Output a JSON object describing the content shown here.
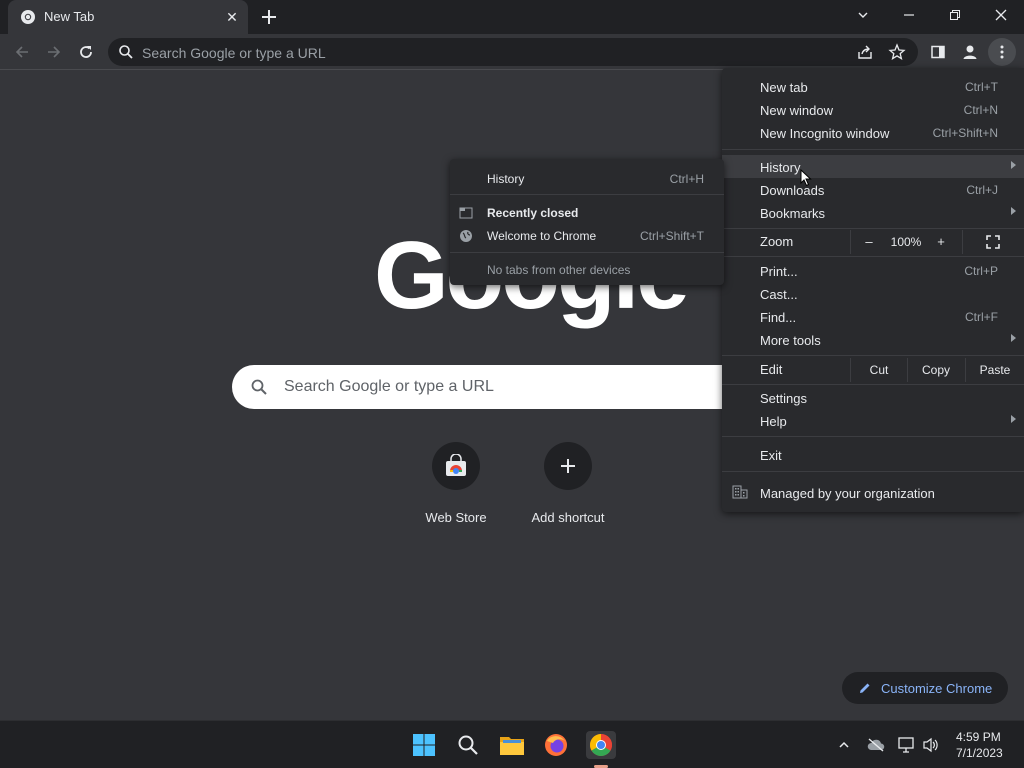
{
  "tab": {
    "title": "New Tab"
  },
  "omnibox": {
    "placeholder": "Search Google or type a URL"
  },
  "logo": {
    "text": "Google"
  },
  "ntp": {
    "search_placeholder": "Search Google or type a URL",
    "shortcuts": [
      {
        "label": "Web Store",
        "icon": "web-store-icon"
      },
      {
        "label": "Add shortcut",
        "icon": "plus-icon"
      }
    ],
    "customize_label": "Customize Chrome"
  },
  "menu": {
    "new_tab": {
      "label": "New tab",
      "shortcut": "Ctrl+T"
    },
    "new_window": {
      "label": "New window",
      "shortcut": "Ctrl+N"
    },
    "new_incognito": {
      "label": "New Incognito window",
      "shortcut": "Ctrl+Shift+N"
    },
    "history": {
      "label": "History"
    },
    "downloads": {
      "label": "Downloads",
      "shortcut": "Ctrl+J"
    },
    "bookmarks": {
      "label": "Bookmarks"
    },
    "zoom": {
      "label": "Zoom",
      "minus": "–",
      "level": "100%",
      "plus": "+"
    },
    "print": {
      "label": "Print...",
      "shortcut": "Ctrl+P"
    },
    "cast": {
      "label": "Cast..."
    },
    "find": {
      "label": "Find...",
      "shortcut": "Ctrl+F"
    },
    "more_tools": {
      "label": "More tools"
    },
    "edit": {
      "label": "Edit",
      "cut": "Cut",
      "copy": "Copy",
      "paste": "Paste"
    },
    "settings": {
      "label": "Settings"
    },
    "help": {
      "label": "Help"
    },
    "exit": {
      "label": "Exit"
    },
    "managed": {
      "label": "Managed by your organization"
    }
  },
  "history_submenu": {
    "history": {
      "label": "History",
      "shortcut": "Ctrl+H"
    },
    "recently_closed": {
      "label": "Recently closed"
    },
    "welcome": {
      "label": "Welcome to Chrome",
      "shortcut": "Ctrl+Shift+T"
    },
    "no_tabs": {
      "label": "No tabs from other devices"
    }
  },
  "taskbar": {
    "time": "4:59 PM",
    "date": "7/1/2023"
  },
  "colors": {
    "background": "#35363a",
    "menu": "#292a2d",
    "accent": "#8ab4f8",
    "chrome_red": "#ea4335",
    "chrome_yellow": "#fbbc04",
    "chrome_green": "#34a853",
    "chrome_blue": "#4285f4"
  }
}
